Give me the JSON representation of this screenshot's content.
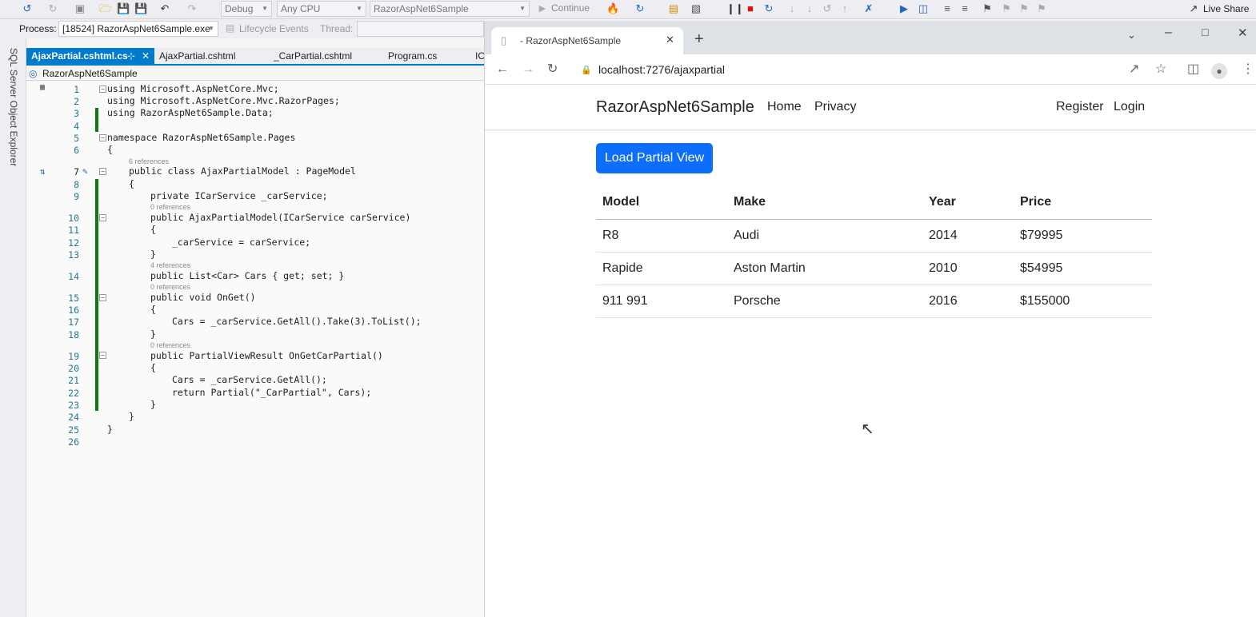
{
  "vs": {
    "toolbar": {
      "config": "Debug",
      "platform": "Any CPU",
      "startup_project": "RazorAspNet6Sample",
      "continue_label": "Continue",
      "live_share_label": "Live Share"
    },
    "process_bar": {
      "process_label": "Process:",
      "process_value": "[18524] RazorAspNet6Sample.exe",
      "lifecycle_label": "Lifecycle Events",
      "thread_label": "Thread:"
    },
    "side_panel_label": "SQL Server Object Explorer",
    "tabs": [
      {
        "label": "AjaxPartial.cshtml.cs",
        "active": true
      },
      {
        "label": "AjaxPartial.cshtml",
        "active": false
      },
      {
        "label": "_CarPartial.cshtml",
        "active": false
      },
      {
        "label": "Program.cs",
        "active": false
      },
      {
        "label": "IC",
        "active": false
      }
    ],
    "nav_project": "RazorAspNet6Sample",
    "line_numbers": [
      "1",
      "2",
      "3",
      "4",
      "5",
      "6",
      "7",
      "8",
      "9",
      "10",
      "11",
      "12",
      "13",
      "14",
      "15",
      "16",
      "17",
      "18",
      "19",
      "20",
      "21",
      "22",
      "23",
      "24",
      "25",
      "26"
    ],
    "code_lines": [
      "using Microsoft.AspNetCore.Mvc;",
      "using Microsoft.AspNetCore.Mvc.RazorPages;",
      "using RazorAspNet6Sample.Data;",
      "",
      "namespace RazorAspNet6Sample.Pages",
      "{",
      "public class AjaxPartialModel : PageModel",
      "{",
      "private ICarService _carService;",
      "public AjaxPartialModel(ICarService carService)",
      "{",
      "_carService = carService;",
      "}",
      "public List<Car> Cars { get; set; }",
      "public void OnGet()",
      "{",
      "Cars = _carService.GetAll().Take(3).ToList();",
      "}",
      "public PartialViewResult OnGetCarPartial()",
      "{",
      "Cars = _carService.GetAll();",
      "return Partial(\"_CarPartial\", Cars);",
      "}",
      "}",
      "}",
      ""
    ],
    "references": {
      "class": "6 references",
      "field_ctor": "0 references",
      "cars_prop": "4 references",
      "on_get": "0 references",
      "on_get_partial": "0 references"
    }
  },
  "browser": {
    "tab_title": "- RazorAspNet6Sample",
    "url": "localhost:7276/ajaxpartial",
    "site": {
      "brand": "RazorAspNet6Sample",
      "nav_left": [
        "Home",
        "Privacy"
      ],
      "nav_right": [
        "Register",
        "Login"
      ],
      "load_button": "Load Partial View",
      "table": {
        "headers": [
          "Model",
          "Make",
          "Year",
          "Price"
        ],
        "rows": [
          [
            "R8",
            "Audi",
            "2014",
            "$79995"
          ],
          [
            "Rapide",
            "Aston Martin",
            "2010",
            "$54995"
          ],
          [
            "911 991",
            "Porsche",
            "2016",
            "$155000"
          ]
        ]
      }
    }
  },
  "colors": {
    "primary_button": "#0d6efd",
    "vs_accent": "#007acc",
    "change_bar": "#107c10"
  }
}
